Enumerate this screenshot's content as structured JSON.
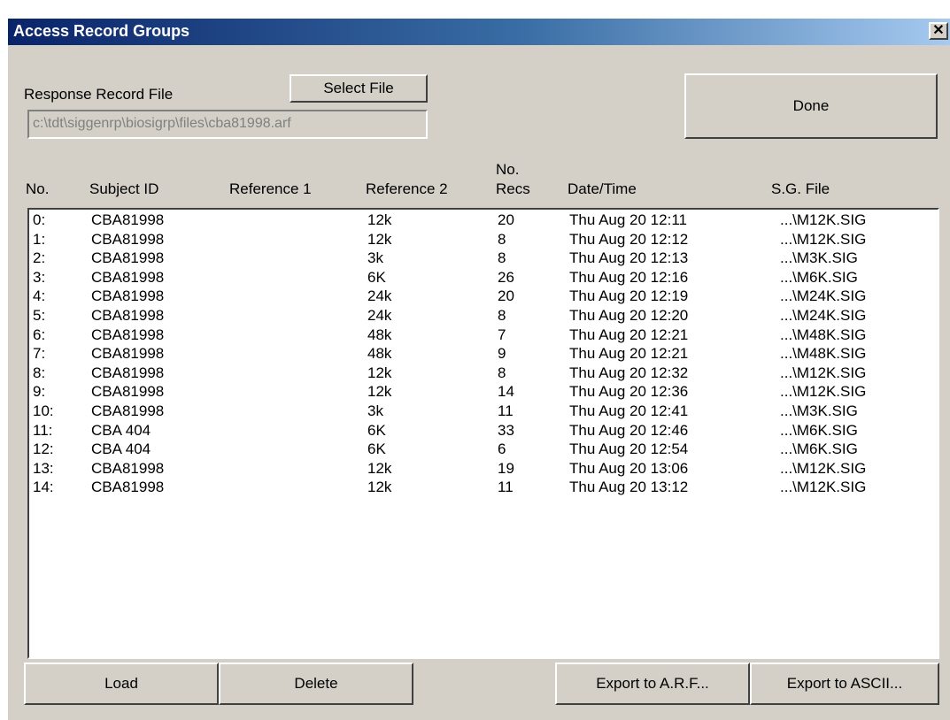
{
  "window": {
    "title": "Access Record Groups",
    "close_glyph": "✕",
    "close_icon": "close-icon"
  },
  "file": {
    "label": "Response Record File",
    "select_label": "Select File",
    "path": "c:\\tdt\\siggenrp\\biosigrp\\files\\cba81998.arf"
  },
  "done_label": "Done",
  "columns": {
    "no": "No.",
    "subject": "Subject ID",
    "ref1": "Reference 1",
    "ref2": "Reference 2",
    "recs_top": "No.",
    "recs_bottom": "Recs",
    "datetime": "Date/Time",
    "sgfile": "S.G. File"
  },
  "rows": [
    {
      "no": "0:",
      "subject": "CBA81998",
      "ref1": "",
      "ref2": "12k",
      "recs": "20",
      "datetime": "Thu Aug 20 12:11",
      "sgfile": "...\\M12K.SIG"
    },
    {
      "no": "1:",
      "subject": "CBA81998",
      "ref1": "",
      "ref2": "12k",
      "recs": "8",
      "datetime": "Thu Aug 20 12:12",
      "sgfile": "...\\M12K.SIG"
    },
    {
      "no": "2:",
      "subject": "CBA81998",
      "ref1": "",
      "ref2": "3k",
      "recs": "8",
      "datetime": "Thu Aug 20 12:13",
      "sgfile": "...\\M3K.SIG"
    },
    {
      "no": "3:",
      "subject": "CBA81998",
      "ref1": "",
      "ref2": "6K",
      "recs": "26",
      "datetime": "Thu Aug 20 12:16",
      "sgfile": "...\\M6K.SIG"
    },
    {
      "no": "4:",
      "subject": "CBA81998",
      "ref1": "",
      "ref2": "24k",
      "recs": "20",
      "datetime": "Thu Aug 20 12:19",
      "sgfile": "...\\M24K.SIG"
    },
    {
      "no": "5:",
      "subject": "CBA81998",
      "ref1": "",
      "ref2": "24k",
      "recs": "8",
      "datetime": "Thu Aug 20 12:20",
      "sgfile": "...\\M24K.SIG"
    },
    {
      "no": "6:",
      "subject": "CBA81998",
      "ref1": "",
      "ref2": "48k",
      "recs": "7",
      "datetime": "Thu Aug 20 12:21",
      "sgfile": "...\\M48K.SIG"
    },
    {
      "no": "7:",
      "subject": "CBA81998",
      "ref1": "",
      "ref2": "48k",
      "recs": "9",
      "datetime": "Thu Aug 20 12:21",
      "sgfile": "...\\M48K.SIG"
    },
    {
      "no": "8:",
      "subject": "CBA81998",
      "ref1": "",
      "ref2": "12k",
      "recs": "8",
      "datetime": "Thu Aug 20 12:32",
      "sgfile": "...\\M12K.SIG"
    },
    {
      "no": "9:",
      "subject": "CBA81998",
      "ref1": "",
      "ref2": "12k",
      "recs": "14",
      "datetime": "Thu Aug 20 12:36",
      "sgfile": "...\\M12K.SIG"
    },
    {
      "no": "10:",
      "subject": "CBA81998",
      "ref1": "",
      "ref2": "3k",
      "recs": "11",
      "datetime": "Thu Aug 20 12:41",
      "sgfile": "...\\M3K.SIG"
    },
    {
      "no": "11:",
      "subject": "CBA 404",
      "ref1": "",
      "ref2": "6K",
      "recs": "33",
      "datetime": "Thu Aug 20 12:46",
      "sgfile": "...\\M6K.SIG"
    },
    {
      "no": "12:",
      "subject": "CBA 404",
      "ref1": "",
      "ref2": "6K",
      "recs": "6",
      "datetime": "Thu Aug 20 12:54",
      "sgfile": "...\\M6K.SIG"
    },
    {
      "no": "13:",
      "subject": "CBA81998",
      "ref1": "",
      "ref2": "12k",
      "recs": "19",
      "datetime": "Thu Aug 20 13:06",
      "sgfile": "...\\M12K.SIG"
    },
    {
      "no": "14:",
      "subject": "CBA81998",
      "ref1": "",
      "ref2": "12k",
      "recs": "11",
      "datetime": "Thu Aug 20 13:12",
      "sgfile": "...\\M12K.SIG"
    }
  ],
  "buttons": {
    "load": "Load",
    "delete": "Delete",
    "export_arf": "Export to A.R.F...",
    "export_ascii": "Export to ASCII..."
  },
  "colors": {
    "titlebar_start": "#0a246a",
    "titlebar_end": "#a6caf0",
    "face": "#d4d0c8"
  }
}
